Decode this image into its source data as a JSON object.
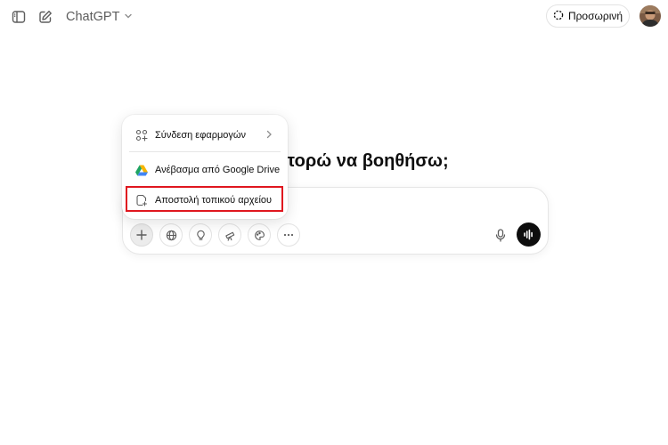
{
  "header": {
    "model_label": "ChatGPT",
    "temporary_label": "Προσωρινή",
    "icons": [
      "sidebar-toggle-icon",
      "new-chat-icon",
      "chevron-down-icon",
      "temporary-chat-icon"
    ]
  },
  "main": {
    "greeting": "Πώς μπορώ να βοηθήσω;"
  },
  "attach_menu": {
    "items": [
      {
        "label": "Σύνδεση εφαρμογών",
        "icon": "apps-icon",
        "has_submenu": true
      },
      {
        "label": "Ανέβασμα από Google Drive",
        "icon": "google-drive-icon",
        "has_submenu": false
      },
      {
        "label": "Αποστολή τοπικού αρχείου",
        "icon": "local-file-icon",
        "has_submenu": false,
        "highlighted": true
      }
    ]
  },
  "composer": {
    "tools": [
      "plus-icon",
      "globe-icon",
      "lightbulb-icon",
      "telescope-icon",
      "paint-icon",
      "more-icon"
    ],
    "mic_icon": "mic-icon",
    "voice_icon": "voice-mode-icon"
  },
  "colors": {
    "highlight": "#e0171f",
    "voice_button": "#0d0d0d",
    "text_muted": "#5d5d5d"
  }
}
